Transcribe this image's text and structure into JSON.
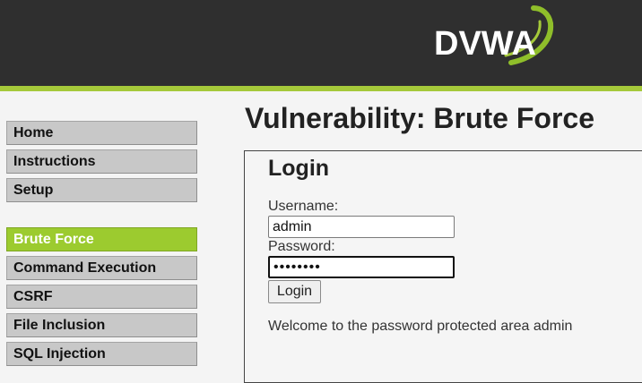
{
  "header": {
    "logo_text": "DVWA",
    "brand_color": "#a5c93a"
  },
  "nav": {
    "group1": [
      {
        "label": "Home"
      },
      {
        "label": "Instructions"
      },
      {
        "label": "Setup"
      }
    ],
    "group2": [
      {
        "label": "Brute Force",
        "active": true
      },
      {
        "label": "Command Execution"
      },
      {
        "label": "CSRF"
      },
      {
        "label": "File Inclusion"
      },
      {
        "label": "SQL Injection"
      }
    ]
  },
  "main": {
    "title": "Vulnerability: Brute Force",
    "login": {
      "heading": "Login",
      "username_label": "Username:",
      "username_value": "admin",
      "password_label": "Password:",
      "password_value": "password",
      "button_label": "Login",
      "welcome_message": "Welcome to the password protected area admin"
    }
  }
}
